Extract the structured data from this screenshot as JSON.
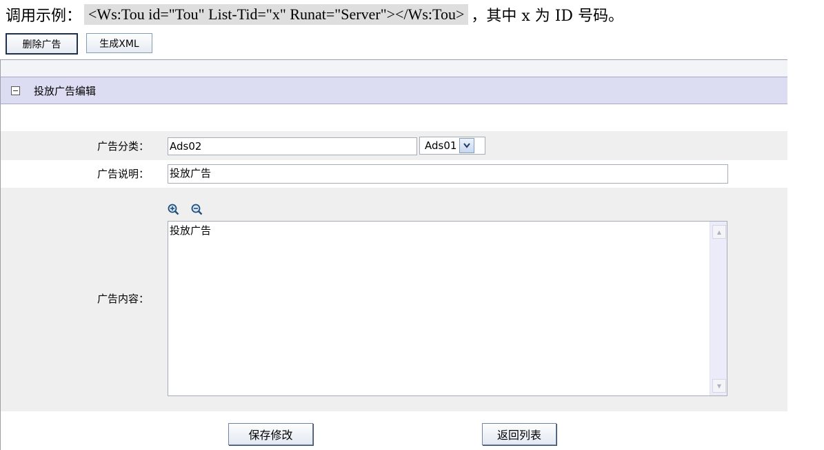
{
  "header": {
    "prefix": "调用示例：",
    "code": "<Ws:Tou id=\"Tou\" List-Tid=\"x\" Runat=\"Server\"></Ws:Tou>",
    "suffix": "，其中 x 为 ID 号码。"
  },
  "toolbar": {
    "delete_label": "删除广告",
    "xml_label": "生成XML"
  },
  "panel": {
    "title": "投放广告编辑"
  },
  "form": {
    "category_label": "广告分类：",
    "category_value": "Ads02",
    "category_select_value": "Ads01",
    "description_label": "广告说明：",
    "description_value": "投放广告",
    "content_label": "广告内容：",
    "content_value": "投放广告"
  },
  "actions": {
    "save_label": "保存修改",
    "back_label": "返回列表"
  },
  "icons": {
    "zoom_in": "zoom-in-icon",
    "zoom_out": "zoom-out-icon",
    "collapse": "collapse-icon",
    "dropdown": "chevron-down-icon"
  }
}
